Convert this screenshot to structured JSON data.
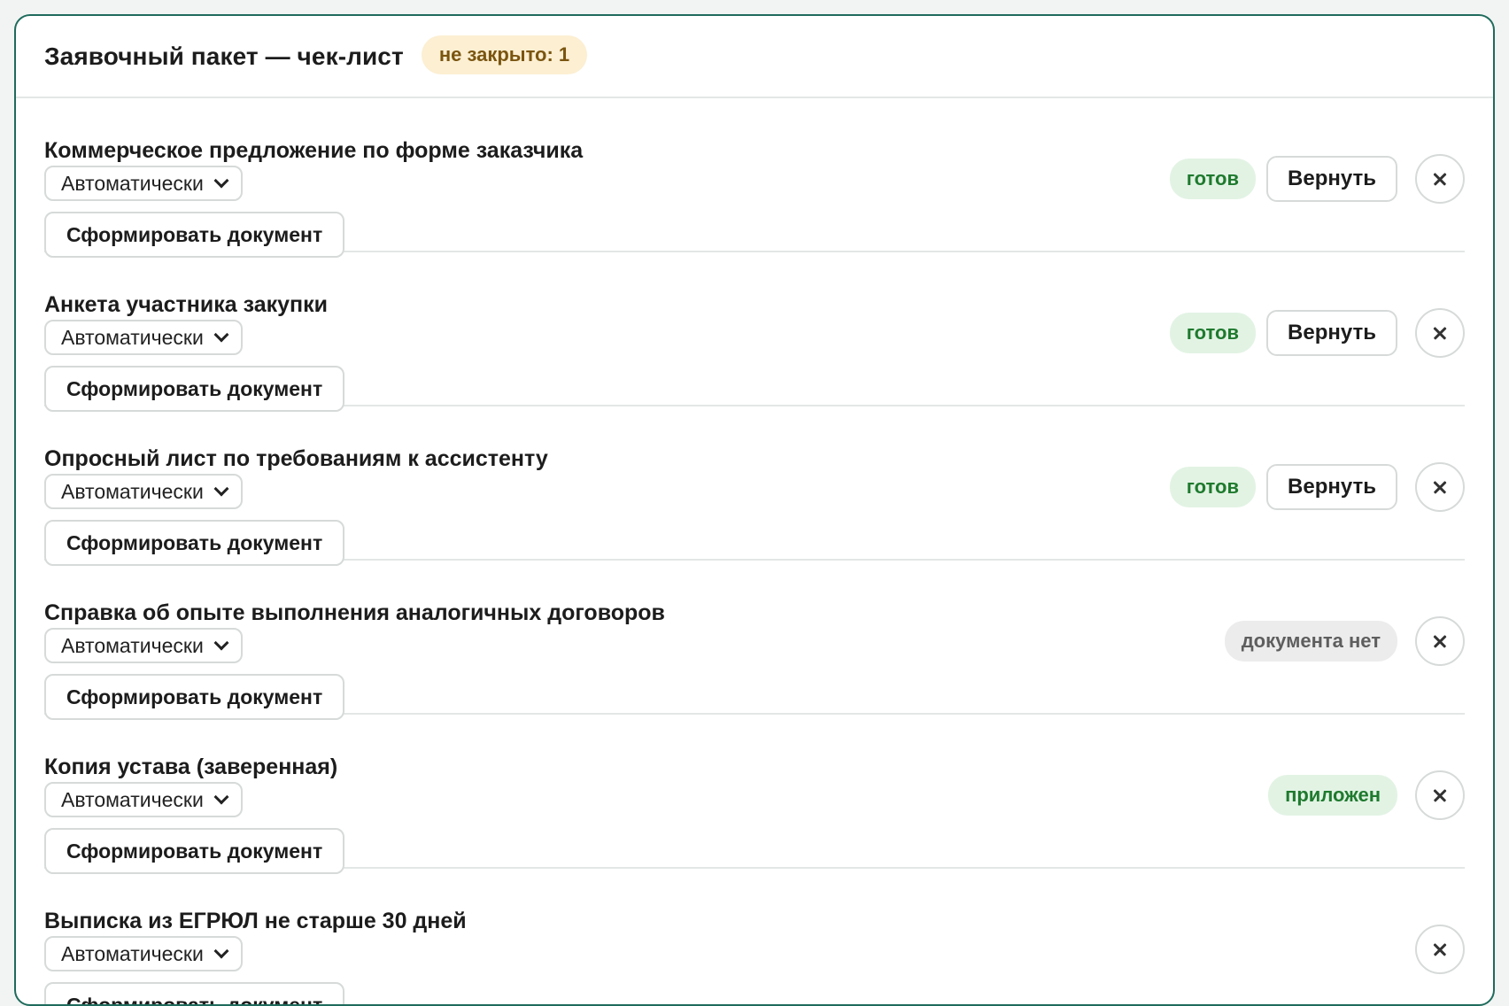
{
  "header": {
    "title": "Заявочный пакет — чек-лист",
    "pending_badge": "не закрыто: 1"
  },
  "colors": {
    "panel_border": "#1f6b5c",
    "status_ready_bg": "#e2f3e4",
    "status_ready_text": "#1f7a2e",
    "status_missing_bg": "#ececec",
    "status_missing_text": "#5e5e5e",
    "pending_bg": "#fcefd2",
    "pending_text": "#7a5510"
  },
  "items": [
    {
      "title": "Коммерческое предложение по форме заказчика",
      "mode": "Автоматически",
      "generate_label": "Сформировать документ",
      "status": "готов",
      "return_label": "Вернуть"
    },
    {
      "title": "Анкета участника закупки",
      "mode": "Автоматически",
      "generate_label": "Сформировать документ",
      "status": "готов",
      "return_label": "Вернуть"
    },
    {
      "title": "Опросный лист по требованиям к ассистенту",
      "mode": "Автоматически",
      "generate_label": "Сформировать документ",
      "status": "готов",
      "return_label": "Вернуть"
    },
    {
      "title": "Справка об опыте выполнения аналогичных договоров",
      "mode": "Автоматически",
      "generate_label": "Сформировать документ",
      "status": "документа нет"
    },
    {
      "title": "Копия устава (заверенная)",
      "mode": "Автоматически",
      "generate_label": "Сформировать документ",
      "status": "приложен"
    },
    {
      "title": "Выписка из ЕГРЮЛ не старше 30 дней",
      "mode": "Автоматически",
      "generate_label": "Сформировать документ"
    }
  ]
}
